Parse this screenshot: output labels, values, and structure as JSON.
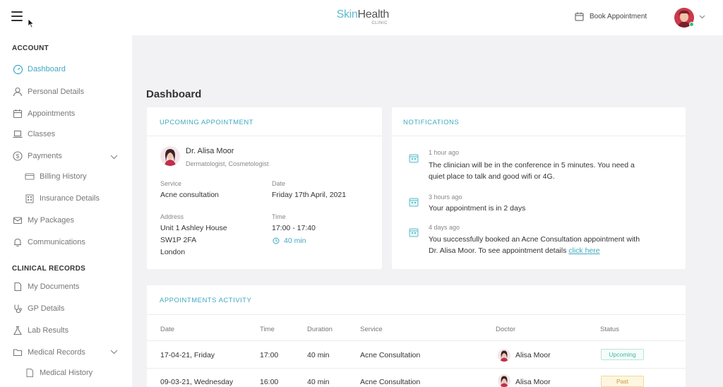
{
  "header": {
    "logo_skin": "Skin",
    "logo_health": "Health",
    "logo_sub": "CLINIC",
    "book_label": "Book Appointment"
  },
  "sidebar": {
    "account_title": "ACCOUNT",
    "clinical_title": "CLINICAL RECORDS",
    "items": {
      "dashboard": "Dashboard",
      "personal": "Personal Details",
      "appointments": "Appointments",
      "classes": "Classes",
      "payments": "Payments",
      "billing": "Billing History",
      "insurance": "Insurance Details",
      "packages": "My Packages",
      "communications": "Communications",
      "documents": "My Documents",
      "gp": "GP Details",
      "lab": "Lab Results",
      "medical": "Medical Records",
      "history": "Medical History"
    }
  },
  "main": {
    "title": "Dashboard",
    "upcoming": {
      "title": "UPCOMING APPOINTMENT",
      "doctor_name": "Dr. Alisa Moor",
      "doctor_role": "Dermatologist, Cosmetologist",
      "service_label": "Service",
      "service_value": "Acne consultation",
      "date_label": "Date",
      "date_value": "Friday 17th April, 2021",
      "address_label": "Address",
      "address_line1": "Unit 1 Ashley House",
      "address_line2": "SW1P 2FA",
      "address_line3": "London",
      "time_label": "Time",
      "time_value": "17:00 - 17:40",
      "duration_value": "40 min"
    },
    "notifications": {
      "title": "NOTIFICATIONS",
      "items": [
        {
          "time": "1 hour ago",
          "line1": "The clinician will be in the conference in 5 minutes. You need a",
          "line2": "quiet place to talk and good wifi or 4G."
        },
        {
          "time": "3 hours ago",
          "line1": "Your appointment is in 2 days"
        },
        {
          "time": "4 days ago",
          "line1": "You successfully booked an Acne Consultation appointment with",
          "line2": "Dr. Alisa Moor. To see appointment details ",
          "link": "click here"
        }
      ]
    },
    "activity": {
      "title": "APPOINTMENTS ACTIVITY",
      "columns": [
        "Date",
        "Time",
        "Duration",
        "Service",
        "Doctor",
        "Status"
      ],
      "rows": [
        {
          "date": "17-04-21, Friday",
          "time": "17:00",
          "duration": "40 min",
          "service": "Acne Consultation",
          "doctor": "Alisa Moor",
          "status": "Upcoming"
        },
        {
          "date": "09-03-21, Wednesday",
          "time": "16:00",
          "duration": "40 min",
          "service": "Acne Consultation",
          "doctor": "Alisa Moor",
          "status": "Past"
        }
      ]
    }
  },
  "colors": {
    "accent": "#3fa9c0",
    "upcoming": "#3fb8a0",
    "past": "#c99a2e",
    "online": "#2ec37a"
  }
}
